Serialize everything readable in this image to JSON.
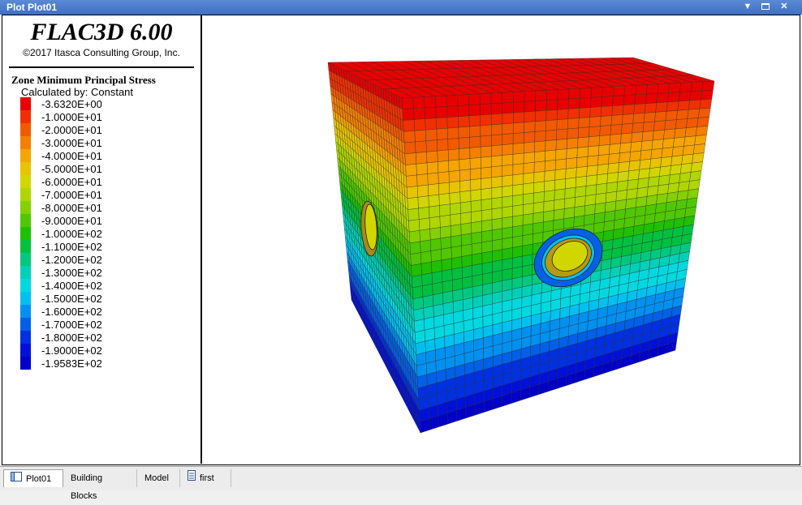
{
  "window": {
    "title": "Plot Plot01",
    "controls": [
      "menu-down-icon",
      "restore-icon",
      "close-icon"
    ]
  },
  "legend": {
    "app_title": "FLAC3D 6.00",
    "copyright": "©2017 Itasca Consulting Group, Inc.",
    "title": "Zone Minimum Principal Stress",
    "subtitle": "Calculated by: Constant",
    "entries": [
      {
        "label": "-3.6320E+00",
        "color": "#e80000"
      },
      {
        "label": "-1.0000E+01",
        "color": "#f03000"
      },
      {
        "label": "-2.0000E+01",
        "color": "#f25a00"
      },
      {
        "label": "-3.0000E+01",
        "color": "#f58000"
      },
      {
        "label": "-4.0000E+01",
        "color": "#f5a500"
      },
      {
        "label": "-5.0000E+01",
        "color": "#e8c400"
      },
      {
        "label": "-6.0000E+01",
        "color": "#d2d600"
      },
      {
        "label": "-7.0000E+01",
        "color": "#b0d600"
      },
      {
        "label": "-8.0000E+01",
        "color": "#84d000"
      },
      {
        "label": "-9.0000E+01",
        "color": "#50c800"
      },
      {
        "label": "-1.0000E+02",
        "color": "#20c000"
      },
      {
        "label": "-1.1000E+02",
        "color": "#00c040"
      },
      {
        "label": "-1.2000E+02",
        "color": "#00c880"
      },
      {
        "label": "-1.3000E+02",
        "color": "#00d0b8"
      },
      {
        "label": "-1.4000E+02",
        "color": "#00d8e0"
      },
      {
        "label": "-1.5000E+02",
        "color": "#00c0f0"
      },
      {
        "label": "-1.6000E+02",
        "color": "#0090f0"
      },
      {
        "label": "-1.7000E+02",
        "color": "#0060e8"
      },
      {
        "label": "-1.8000E+02",
        "color": "#0030e0"
      },
      {
        "label": "-1.9000E+02",
        "color": "#0010d8"
      },
      {
        "label": "-1.9583E+02",
        "color": "#0000c8"
      }
    ]
  },
  "tabs": [
    {
      "label": "Plot01",
      "icon": "plot-window-icon",
      "active": true
    },
    {
      "label": "Building Blocks",
      "active": false
    },
    {
      "label": "Model",
      "active": false
    },
    {
      "label": "first",
      "icon": "document-icon",
      "active": false
    }
  ]
}
